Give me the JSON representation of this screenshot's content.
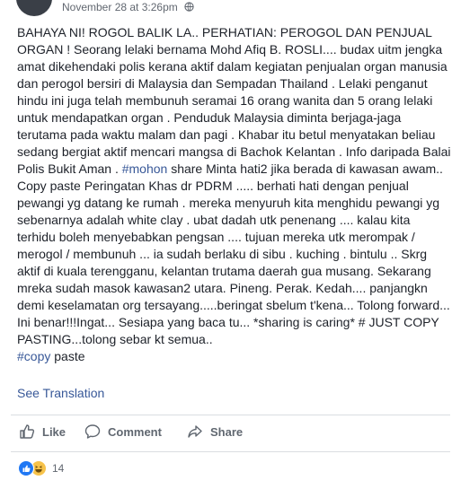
{
  "header": {
    "timestamp": "November 28 at 3:26pm",
    "icons": [
      "avatar",
      "globe-icon"
    ]
  },
  "post": {
    "segments": [
      {
        "text": "BAHAYA NI! ROGOL BALIK LA.. PERHATIAN: PEROGOL DAN PENJUAL ORGAN ! Seorang lelaki bernama Mohd Afiq B. ROSLI.... budax uitm jengka amat dikehendaki polis kerana aktif dalam kegiatan penjualan organ manusia dan perogol bersiri di Malaysia dan Sempadan Thailand . Lelaki penganut hindu ini juga telah membunuh seramai 16 orang wanita dan 5 orang lelaki untuk mendapatkan organ . Penduduk Malaysia diminta berjaga-jaga terutama pada waktu malam dan pagi . Khabar itu betul menyatakan beliau sedang bergiat aktif mencari mangsa di Bachok Kelantan . Info daripada Balai Polis Bukit Aman . "
      },
      {
        "text": "#mohon",
        "hashtag": true
      },
      {
        "text": " share Minta hati2 jika berada di kawasan awam.. Copy paste Peringatan Khas dr PDRM ..... berhati hati dengan penjual pewangi yg datang ke rumah . mereka menyuruh kita menghidu pewangi yg sebenarnya adalah white clay . ubat dadah utk penenang .... kalau kita terhidu boleh menyebabkan pengsan .... tujuan mereka utk merompak / merogol / membunuh ... ia sudah berlaku di sibu . kuching . bintulu .. Skrg aktif di kuala terengganu, kelantan trutama daerah gua musang. Sekarang mreka sudah masok kawasan2 utara. Pineng. Perak. Kedah.... panjangkn demi keselamatan org tersayang.....beringat sbelum t'kena... Tolong forward... Ini benar!!!Ingat... Sesiapa yang baca tu... *sharing is caring* # JUST COPY PASTING...tolong sebar kt semua.."
      },
      {
        "text": "#copy",
        "hashtag": true
      },
      {
        "text": " paste"
      }
    ],
    "see_translation": "See Translation"
  },
  "actions": {
    "like": "Like",
    "comment": "Comment",
    "share": "Share"
  },
  "reactions": {
    "count": "14",
    "types": [
      "like",
      "haha"
    ]
  },
  "colors": {
    "link": "#385898",
    "text": "#1d2129",
    "muted": "#616770",
    "action": "#606770",
    "divider": "#dadde1"
  }
}
